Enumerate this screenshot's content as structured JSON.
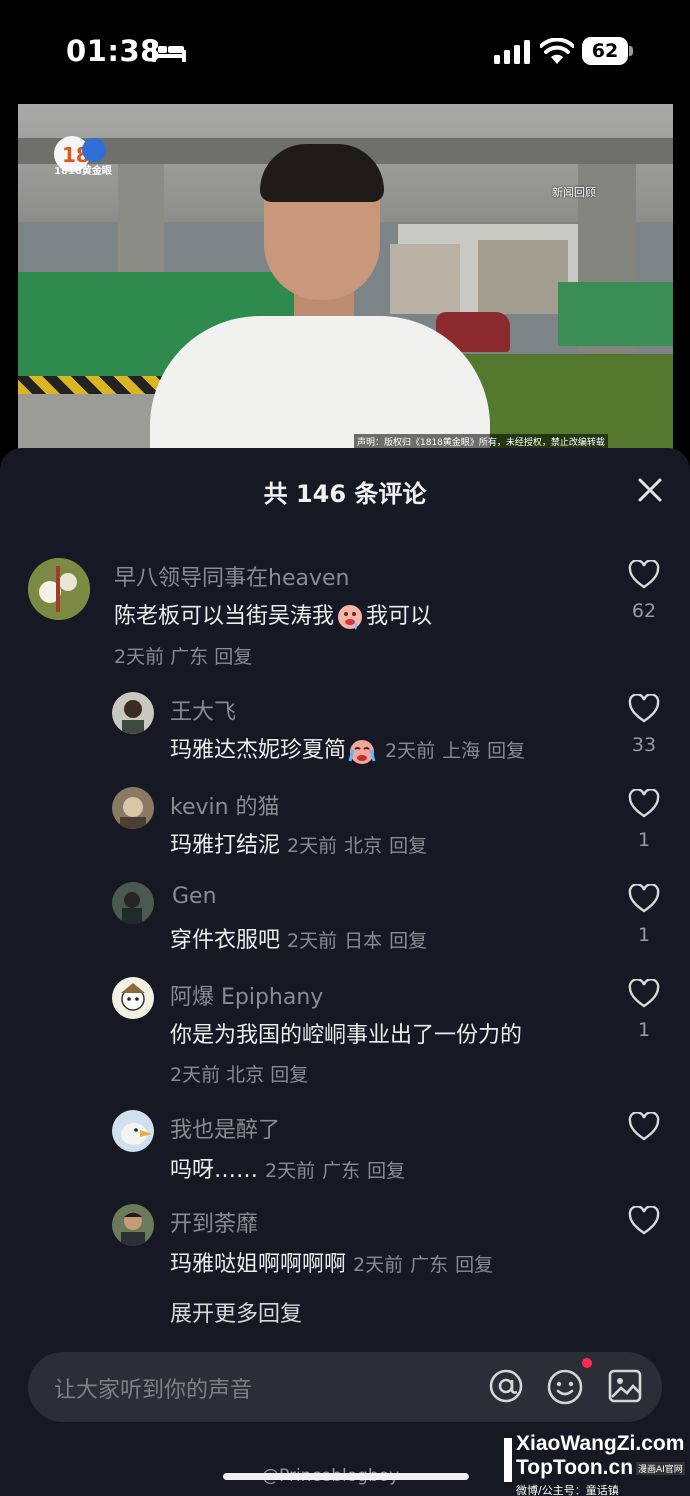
{
  "status_bar": {
    "time": "01:38",
    "battery": "62"
  },
  "video": {
    "logo_text": "1818黄金眼",
    "news_label": "新闻回顾",
    "disclaimer": "声明：版权归《1818黄金眼》所有，未经授权，禁止改编转载"
  },
  "comments_sheet": {
    "title": "共 146 条评论",
    "comments": [
      {
        "user": "早八领导同事在heaven",
        "text_before": "陈老板可以当街吴涛我",
        "emoji": "drooling-face",
        "text_after": "我可以",
        "time": "2天前",
        "location": "广东",
        "reply": "回复",
        "likes": "62"
      }
    ],
    "replies": [
      {
        "user": "王大飞",
        "text": "玛雅达杰妮珍夏简",
        "emoji": "crying-face",
        "time": "2天前",
        "location": "上海",
        "reply": "回复",
        "likes": "33"
      },
      {
        "user": "kevin 的猫",
        "text": "玛雅打结泥",
        "time": "2天前",
        "location": "北京",
        "reply": "回复",
        "likes": "1"
      },
      {
        "user": "Gen",
        "text": "穿件衣服吧",
        "time": "2天前",
        "location": "日本",
        "reply": "回复",
        "likes": "1"
      },
      {
        "user": "阿爆 Epiphany",
        "text": "你是为我国的崆峒事业出了一份力的",
        "time": "2天前",
        "location": "北京",
        "reply": "回复",
        "likes": "1"
      },
      {
        "user": "我也是醉了",
        "text": "吗呀……",
        "time": "2天前",
        "location": "广东",
        "reply": "回复",
        "likes": ""
      },
      {
        "user": "开到荼靡",
        "text": "玛雅哒姐啊啊啊啊",
        "time": "2天前",
        "location": "广东",
        "reply": "回复",
        "likes": ""
      }
    ],
    "expand_more": "展开更多回复"
  },
  "input": {
    "placeholder": "让大家听到你的声音"
  },
  "weibo_handle": "@Princeblogboy",
  "watermark": {
    "line1": "XiaoWangZi.com",
    "line2": "TopToon.cn",
    "tag": "漫画AI官网",
    "line3": "微博/公主号：童话镇"
  },
  "colors": {
    "sheet_bg": "#161823",
    "input_bg": "#2b2d37",
    "muted_text": "#8a8b91",
    "notification_dot": "#fe2c55"
  }
}
